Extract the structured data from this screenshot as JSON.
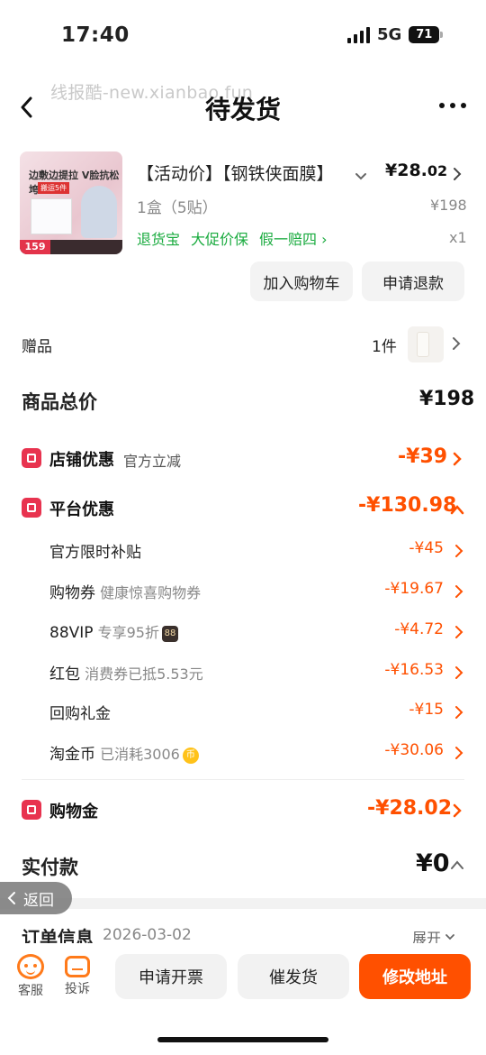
{
  "status": {
    "time": "17:40",
    "network": "5G",
    "battery": "71"
  },
  "watermark": "线报酷-new.xianbao.fun",
  "nav": {
    "title": "待发货"
  },
  "product": {
    "title": "【活动价】【钢铁侠面膜】",
    "price_int": "¥28.",
    "price_dec": "02",
    "spec": "1盒（5贴）",
    "original_price": "¥198",
    "tags": [
      "退货宝",
      "大促价保",
      "假一赔四 ›"
    ],
    "quantity": "x1",
    "thumb": {
      "head": "边敷边提拉 V脸抗松垮",
      "sub": "搬运5件",
      "price": "159"
    }
  },
  "actions": {
    "add_cart": "加入购物车",
    "refund": "申请退款"
  },
  "gift": {
    "label": "赠品",
    "count": "1件"
  },
  "total": {
    "label": "商品总价",
    "value": "¥198"
  },
  "store_discount": {
    "label": "店铺优惠",
    "sub": "官方立减",
    "amount": "-¥39"
  },
  "platform_discount": {
    "label": "平台优惠",
    "amount": "-¥130.98",
    "items": [
      {
        "label": "官方限时补贴",
        "hint": "",
        "amount": "-¥45"
      },
      {
        "label": "购物券",
        "hint": "健康惊喜购物券",
        "amount": "-¥19.67"
      },
      {
        "label": "88VIP",
        "hint": "专享95折",
        "amount": "-¥4.72",
        "badge": "88"
      },
      {
        "label": "红包",
        "hint": "消费券已抵5.53元",
        "amount": "-¥16.53"
      },
      {
        "label": "回购礼金",
        "hint": "",
        "amount": "-¥15"
      },
      {
        "label": "淘金币",
        "hint": "已消耗3006",
        "amount": "-¥30.06",
        "badge": "币"
      }
    ]
  },
  "shopping_cash": {
    "label": "购物金",
    "amount": "-¥28.02"
  },
  "paid": {
    "label": "实付款",
    "amount": "¥0"
  },
  "return_pill": "返回",
  "order_info": {
    "label": "订单信息",
    "date": "2026-03-02",
    "expand": "展开"
  },
  "bottom": {
    "customer_service": "客服",
    "complain": "投诉",
    "invoice": "申请开票",
    "urge": "催发货",
    "address": "修改地址"
  },
  "colors": {
    "accent": "#ff5000",
    "green": "#1aab3f",
    "icon_red": "#e8334f"
  }
}
